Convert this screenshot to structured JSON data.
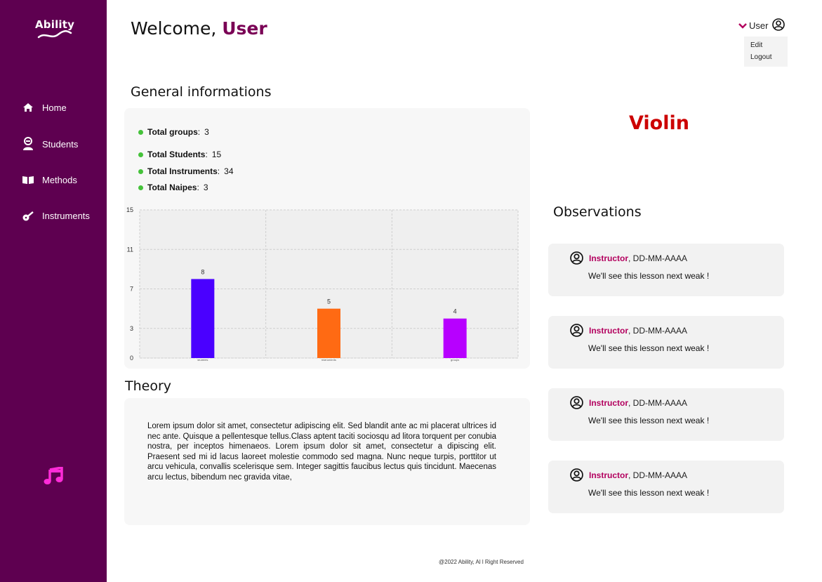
{
  "app": {
    "logo_text": "Ability"
  },
  "sidebar": {
    "items": [
      {
        "label": "Home",
        "icon": "home-icon"
      },
      {
        "label": "Students",
        "icon": "student-icon"
      },
      {
        "label": "Methods",
        "icon": "book-icon"
      },
      {
        "label": "Instruments",
        "icon": "guitar-icon"
      }
    ],
    "bottom_icon": "music-note-icon",
    "color": "#5e0050"
  },
  "header": {
    "welcome_prefix": "Welcome, ",
    "welcome_name": "User",
    "user_label": "User",
    "dropdown": [
      "Edit",
      "Logout"
    ]
  },
  "general": {
    "title": "General informations",
    "stats": [
      {
        "label": "Total groups",
        "value": "3"
      },
      {
        "label": "Total Students",
        "value": "15"
      },
      {
        "label": "Total Instruments",
        "value": "34"
      },
      {
        "label": "Total Naipes",
        "value": "3"
      }
    ]
  },
  "chart_data": {
    "type": "bar",
    "categories": [
      "students",
      "instruments",
      "groups"
    ],
    "values": [
      8,
      5,
      4
    ],
    "colors": [
      "#4a00ff",
      "#ff6a13",
      "#b700ff"
    ],
    "yticks": [
      0,
      3,
      7,
      11,
      15
    ],
    "ylim": [
      0,
      15
    ],
    "grid": true
  },
  "instrument": {
    "name": "Violin"
  },
  "observations": {
    "title": "Observations",
    "items": [
      {
        "author": "Instructor",
        "date": ", DD-MM-AAAA",
        "text": "We'll see this lesson next weak !"
      },
      {
        "author": "Instructor",
        "date": ", DD-MM-AAAA",
        "text": "We'll see this lesson next weak !"
      },
      {
        "author": "Instructor",
        "date": ", DD-MM-AAAA",
        "text": "We'll see this lesson next weak !"
      },
      {
        "author": "Instructor",
        "date": ", DD-MM-AAAA",
        "text": "We'll see this lesson next weak !"
      }
    ]
  },
  "theory": {
    "title": "Theory",
    "text": "Lorem ipsum dolor sit amet, consectetur adipiscing elit. Sed blandit ante ac mi placerat ultrices id nec ante. Quisque a pellentesque tellus.Class aptent taciti sociosqu ad litora torquent per conubia nostra, per inceptos himenaeos. Lorem ipsum dolor sit amet, consectetur a dipiscing elit. Praesent sed mi id lacus laoreet molestie commodo sed magna. Nunc neque turpis, porttitor ut arcu vehicula, convallis scelerisque sem. Integer sagittis faucibus lectus quis tincidunt. Maecenas arcu lectus, bibendum nec gravida vitae,"
  },
  "footer": {
    "text": "@2022 Ability, Al l Right Reserved"
  }
}
